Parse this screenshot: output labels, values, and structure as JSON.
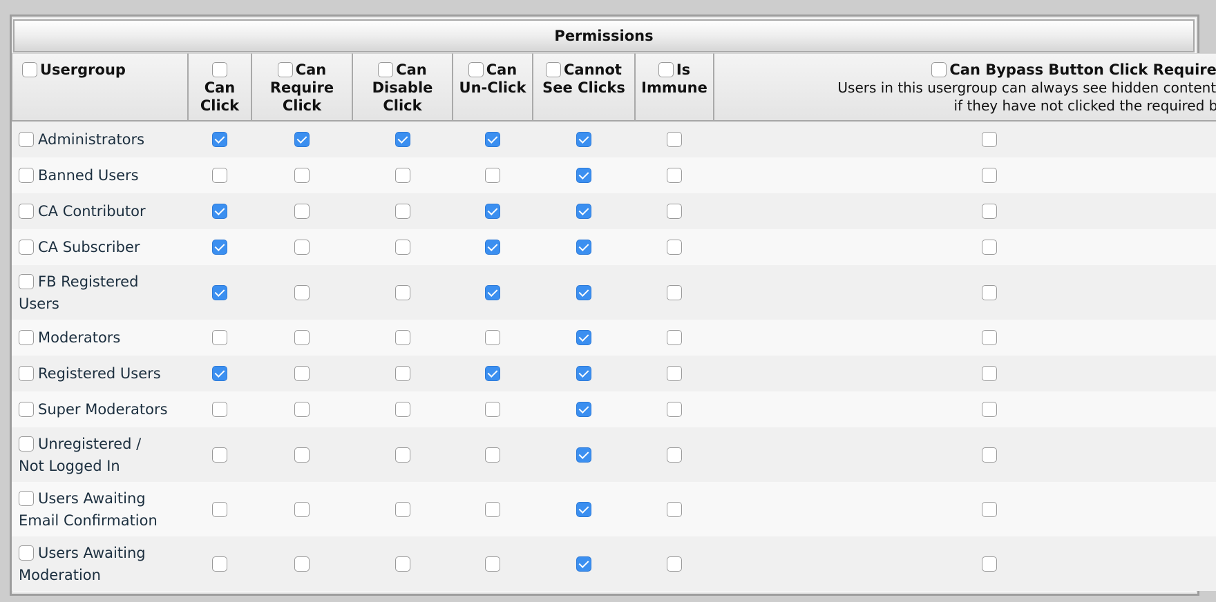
{
  "title": "Permissions",
  "columns": {
    "usergroup": "Usergroup",
    "can_click": [
      "Can",
      "Click"
    ],
    "can_require_click": [
      "Can",
      "Require",
      "Click"
    ],
    "can_disable_click": [
      "Can",
      "Disable",
      "Click"
    ],
    "can_unclick": [
      "Can",
      "Un-Click"
    ],
    "cannot_see_clicks": [
      "Cannot",
      "See Clicks"
    ],
    "is_immune": [
      "Is",
      "Immune"
    ],
    "can_bypass": {
      "label": "Can Bypass Button Click Requirement",
      "description_line1": "Users in this usergroup can always see hidden content, even",
      "description_line2": "if they have not clicked the required button."
    }
  },
  "header_checkboxes": {
    "usergroup": false,
    "can_click": false,
    "can_require_click": false,
    "can_disable_click": false,
    "can_unclick": false,
    "cannot_see_clicks": false,
    "is_immune": false,
    "can_bypass": false
  },
  "rows": [
    {
      "name": [
        "Administrators"
      ],
      "selected": false,
      "perms": [
        true,
        true,
        true,
        true,
        true,
        false,
        false
      ]
    },
    {
      "name": [
        "Banned Users"
      ],
      "selected": false,
      "perms": [
        false,
        false,
        false,
        false,
        true,
        false,
        false
      ]
    },
    {
      "name": [
        "CA Contributor"
      ],
      "selected": false,
      "perms": [
        true,
        false,
        false,
        true,
        true,
        false,
        false
      ]
    },
    {
      "name": [
        "CA Subscriber"
      ],
      "selected": false,
      "perms": [
        true,
        false,
        false,
        true,
        true,
        false,
        false
      ]
    },
    {
      "name": [
        "FB Registered",
        "Users"
      ],
      "selected": false,
      "perms": [
        true,
        false,
        false,
        true,
        true,
        false,
        false
      ]
    },
    {
      "name": [
        "Moderators"
      ],
      "selected": false,
      "perms": [
        false,
        false,
        false,
        false,
        true,
        false,
        false
      ]
    },
    {
      "name": [
        "Registered Users"
      ],
      "selected": false,
      "perms": [
        true,
        false,
        false,
        true,
        true,
        false,
        false
      ]
    },
    {
      "name": [
        "Super Moderators"
      ],
      "selected": false,
      "perms": [
        false,
        false,
        false,
        false,
        true,
        false,
        false
      ]
    },
    {
      "name": [
        "Unregistered /",
        "Not Logged In"
      ],
      "selected": false,
      "perms": [
        false,
        false,
        false,
        false,
        true,
        false,
        false
      ]
    },
    {
      "name": [
        "Users Awaiting",
        "Email Confirmation"
      ],
      "selected": false,
      "perms": [
        false,
        false,
        false,
        false,
        true,
        false,
        false
      ]
    },
    {
      "name": [
        "Users Awaiting",
        "Moderation"
      ],
      "selected": false,
      "perms": [
        false,
        false,
        false,
        false,
        true,
        false,
        false
      ]
    }
  ],
  "perm_keys": [
    "can-click",
    "can-require-click",
    "can-disable-click",
    "can-unclick",
    "cannot-see-clicks",
    "is-immune",
    "can-bypass"
  ],
  "colors": {
    "checkbox_checked": "#3b8ff0",
    "row_odd": "#f0f0f0",
    "row_even": "#f8f8f8",
    "group_text": "#1c2f3f"
  }
}
